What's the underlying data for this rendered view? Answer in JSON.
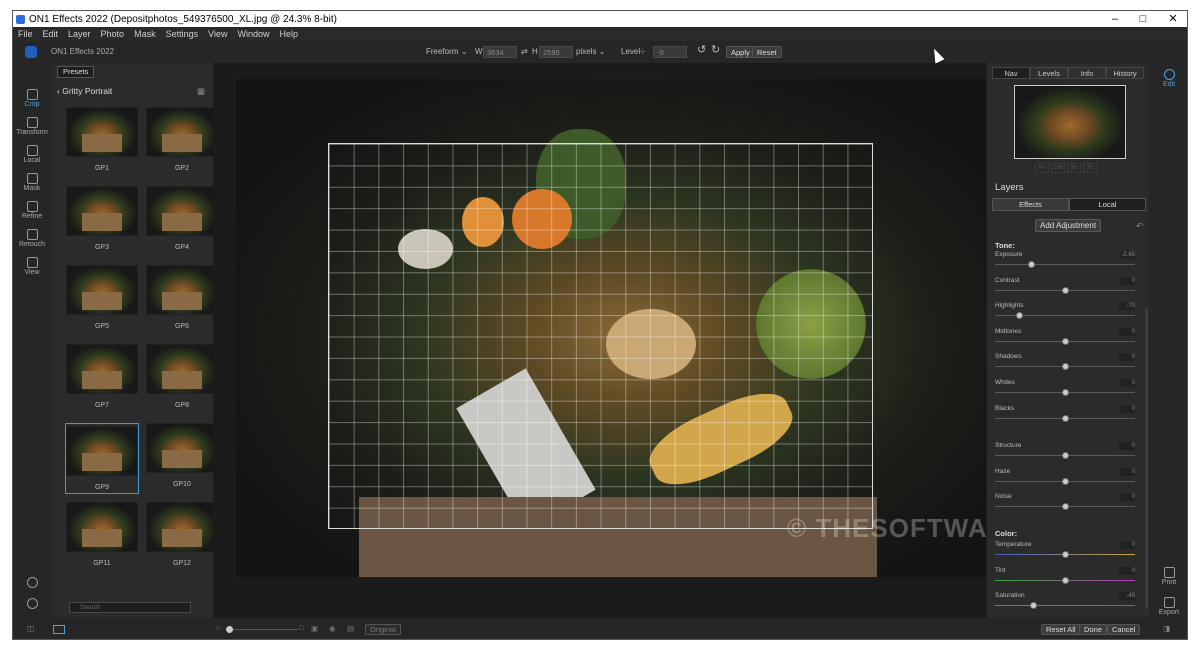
{
  "window": {
    "title": "ON1 Effects 2022 (Depositphotos_549376500_XL.jpg @ 24.3% 8-bit)",
    "minimize": "–",
    "maximize": "□",
    "close": "✕"
  },
  "menu": [
    "File",
    "Edit",
    "Layer",
    "Photo",
    "Mask",
    "Settings",
    "View",
    "Window",
    "Help"
  ],
  "app_name": "ON1 Effects 2022",
  "crop_toolbar": {
    "mode": "Freeform",
    "w_label": "W",
    "w_value": "3634",
    "h_label": "H",
    "h_value": "2595",
    "units": "pixels",
    "level_label": "Level",
    "level_value": "-0",
    "apply": "Apply",
    "reset": "Reset"
  },
  "left_rail": [
    {
      "label": "Crop",
      "icon": "crop-icon",
      "active": true
    },
    {
      "label": "Transform",
      "icon": "transform-icon",
      "active": false
    },
    {
      "label": "Local",
      "icon": "brush-icon",
      "active": false
    },
    {
      "label": "Mask",
      "icon": "mask-icon",
      "active": false
    },
    {
      "label": "Refine",
      "icon": "refine-icon",
      "active": false
    },
    {
      "label": "Retouch",
      "icon": "retouch-icon",
      "active": false
    },
    {
      "label": "View",
      "icon": "view-icon",
      "active": false
    }
  ],
  "presets": {
    "button": "Presets",
    "category": "Gritty Portrait",
    "items": [
      "GP1",
      "GP2",
      "GP3",
      "GP4",
      "GP5",
      "GP6",
      "GP7",
      "GP8",
      "GP9",
      "GP10",
      "GP11",
      "GP12"
    ],
    "selected": "GP9",
    "search_placeholder": "Search"
  },
  "watermark": "© THESOFTWARE.SHOP",
  "bottom": {
    "original": "Original",
    "reset_all": "Reset All",
    "done": "Done",
    "cancel": "Cancel"
  },
  "nav_tabs": [
    "Nav",
    "Levels",
    "Info",
    "History"
  ],
  "nav_active": "Nav",
  "zoom_buttons": [
    "Fit",
    "100",
    "50",
    "25"
  ],
  "layers": {
    "title": "Layers",
    "tabs": [
      "Effects",
      "Local"
    ],
    "active_tab": "Effects",
    "add_adjustment": "Add Adjustment"
  },
  "tone": {
    "heading": "Tone:",
    "sliders": [
      {
        "label": "Exposure",
        "value": "-2.65",
        "pos": 0.26
      },
      {
        "label": "Contrast",
        "value": "0",
        "pos": 0.5
      },
      {
        "label": "Highlights",
        "value": "-70",
        "pos": 0.17
      },
      {
        "label": "Midtones",
        "value": "0",
        "pos": 0.5
      },
      {
        "label": "Shadows",
        "value": "0",
        "pos": 0.5
      },
      {
        "label": "Whites",
        "value": "0",
        "pos": 0.5
      },
      {
        "label": "Blacks",
        "value": "0",
        "pos": 0.5
      }
    ]
  },
  "detail": {
    "sliders": [
      {
        "label": "Structure",
        "value": "0",
        "pos": 0.5
      },
      {
        "label": "Haze",
        "value": "0",
        "pos": 0.5
      },
      {
        "label": "Noise",
        "value": "0",
        "pos": 0.5
      }
    ]
  },
  "color": {
    "heading": "Color:",
    "sliders": [
      {
        "label": "Temperature",
        "value": "0",
        "pos": 0.5
      },
      {
        "label": "Tint",
        "value": "0",
        "pos": 0.5
      },
      {
        "label": "Saturation",
        "value": "-45",
        "pos": 0.27
      }
    ]
  },
  "edge_rail": [
    {
      "label": "Edit",
      "icon": "edit-icon",
      "active": true
    },
    {
      "label": "Print",
      "icon": "print-icon",
      "active": false
    },
    {
      "label": "Export",
      "icon": "export-icon",
      "active": false
    }
  ]
}
